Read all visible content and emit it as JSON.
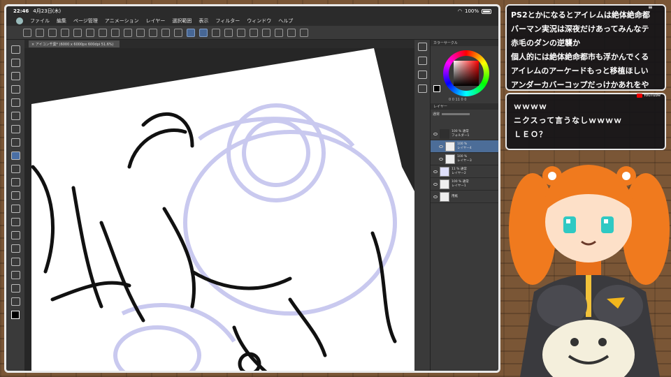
{
  "status_bar": {
    "time": "22:46",
    "date": "4月23日(木)",
    "battery": "100%"
  },
  "menu": [
    "ファイル",
    "編集",
    "ページ管理",
    "アニメーション",
    "レイヤー",
    "選択範囲",
    "表示",
    "フィルター",
    "ウィンドウ",
    "ヘルプ"
  ],
  "document_tab": "× アイコン千葉* (6000 x 6000px 600dpi 51.6%)",
  "panels": {
    "color_circle_title": "カラーサークル",
    "hsv_readout": "0  0  11  0  0",
    "layer_panel_title": "レイヤー",
    "blend_mode": "通常",
    "layers": [
      {
        "opacity_mode": "100 % 通常",
        "name": "フォルダー1",
        "type": "folder"
      },
      {
        "opacity_mode": "100 %",
        "name": "レイヤー4",
        "type": "layer",
        "selected": true
      },
      {
        "opacity_mode": "100 %",
        "name": "レイヤー3",
        "type": "layer"
      },
      {
        "opacity_mode": "11 % 通常",
        "name": "レイヤー2",
        "type": "layer"
      },
      {
        "opacity_mode": "100 % 通常",
        "name": "レイヤー1",
        "type": "layer"
      },
      {
        "opacity_mode": "",
        "name": "用紙",
        "type": "paper"
      }
    ]
  },
  "chat_top": [
    "PS2とかになるとアイレムは絶体絶命都",
    "バーマン実況は深夜だけあってみんなテ",
    "赤毛のダンの逆襲か",
    "個人的には絶体絶命都市も浮かんでくる",
    "アイレムのアーケードもっと移植ほしい",
    "アンダーカバーコップだっけかあれをや"
  ],
  "chat_bottom": {
    "badge": "YouTube",
    "lines": [
      "ｗｗｗｗ",
      "ニクスって言うなしｗｗｗｗ",
      "ＬＥＯ？"
    ]
  },
  "colors": {
    "sketch_blue": "#c9c9ef",
    "selected_layer": "#4c6d98",
    "avatar_hair": "#f07a1e",
    "avatar_sweater": "#3a3a3e"
  }
}
